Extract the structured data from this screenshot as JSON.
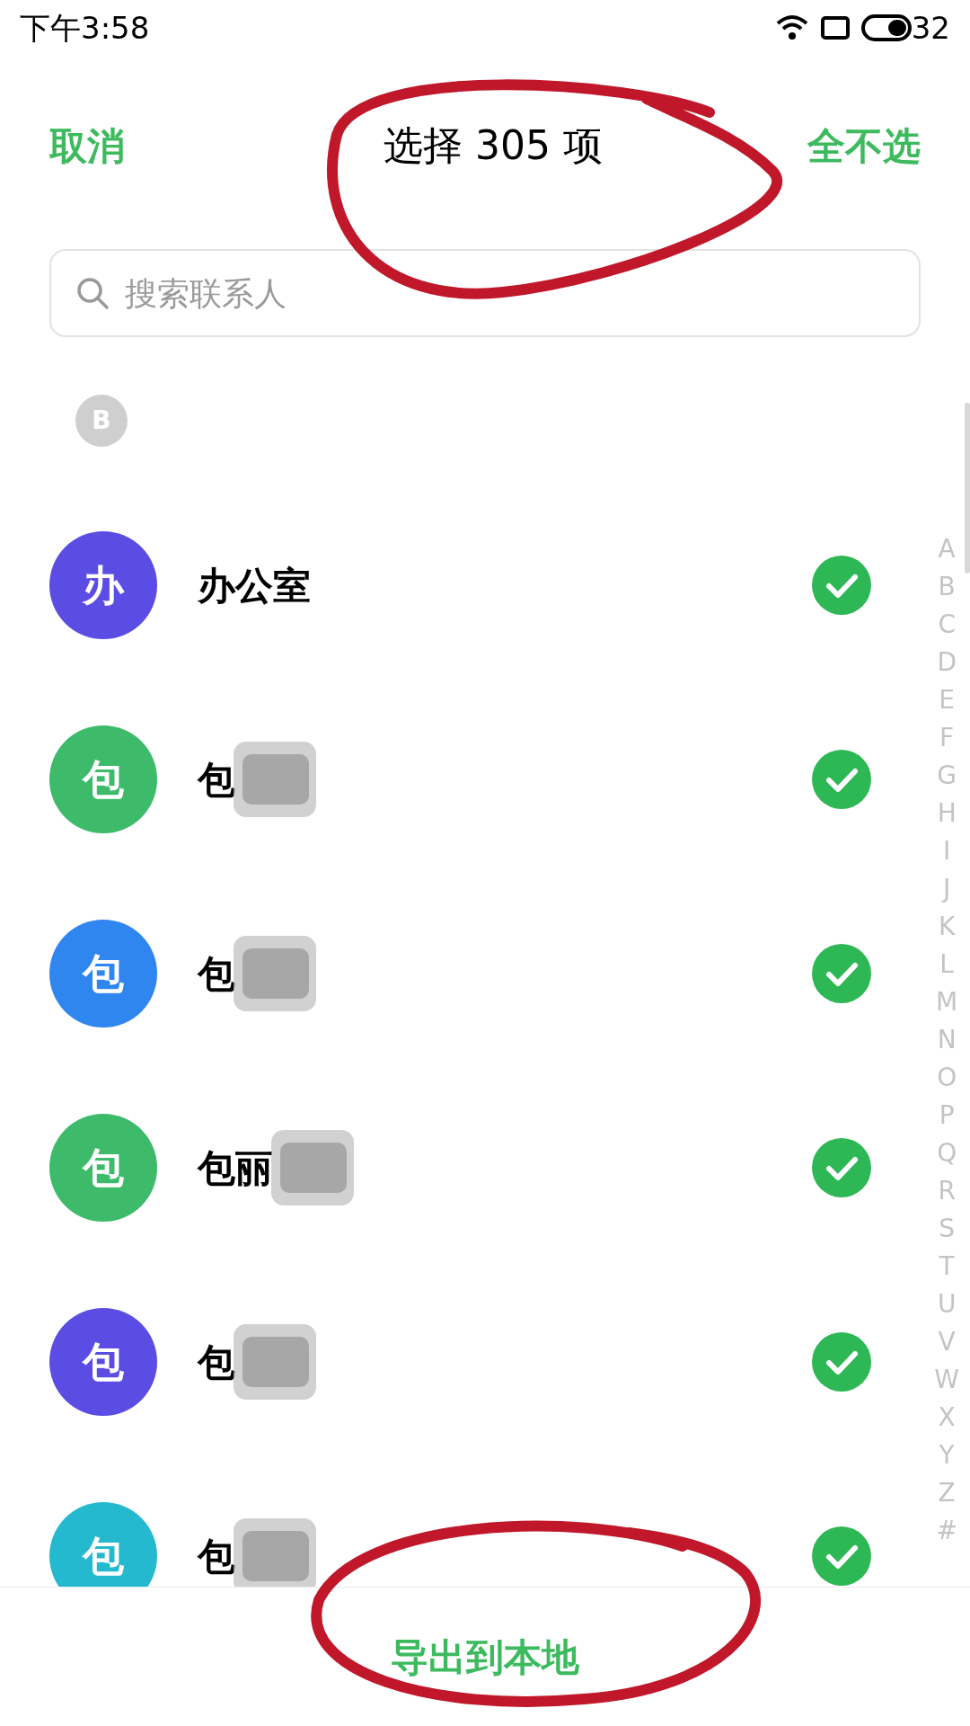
{
  "status_bar": {
    "time": "下午3:58",
    "battery": "32"
  },
  "header": {
    "cancel": "取消",
    "title": "选择 305 项",
    "deselect_all": "全不选"
  },
  "search": {
    "placeholder": "搜索联系人"
  },
  "section": {
    "letter": "B"
  },
  "contacts": [
    {
      "avatar": "办",
      "name": "办公室",
      "color": "#5b4de3",
      "checked": true,
      "redacted": false
    },
    {
      "avatar": "包",
      "name": "包",
      "color": "#3dbb6b",
      "checked": true,
      "redacted": true
    },
    {
      "avatar": "包",
      "name": "包",
      "color": "#2f86ef",
      "checked": true,
      "redacted": true
    },
    {
      "avatar": "包",
      "name": "包丽",
      "color": "#3dbb6b",
      "checked": true,
      "redacted": true
    },
    {
      "avatar": "包",
      "name": "包",
      "color": "#5b4de3",
      "checked": true,
      "redacted": true
    },
    {
      "avatar": "包",
      "name": "包",
      "color": "#25b9cf",
      "checked": true,
      "redacted": true
    }
  ],
  "index": [
    "A",
    "B",
    "C",
    "D",
    "E",
    "F",
    "G",
    "H",
    "I",
    "J",
    "K",
    "L",
    "M",
    "N",
    "O",
    "P",
    "Q",
    "R",
    "S",
    "T",
    "U",
    "V",
    "W",
    "X",
    "Y",
    "Z",
    "#"
  ],
  "bottom": {
    "export": "导出到本地"
  }
}
